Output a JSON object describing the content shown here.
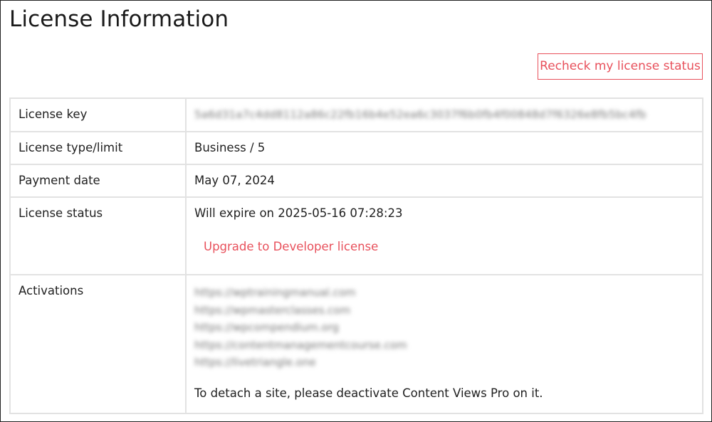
{
  "page": {
    "title": "License Information"
  },
  "actions": {
    "recheck_label": "Recheck my license status"
  },
  "table": {
    "rows": [
      {
        "label": "License key",
        "value": "5a6d31a7c4dd8112a86c22fb16b4e52ea6c3037f6b0fb4f00848d7f6326e8fb5bc4fb"
      },
      {
        "label": "License type/limit",
        "value": "Business / 5"
      },
      {
        "label": "Payment date",
        "value": "May 07, 2024"
      },
      {
        "label": "License status",
        "value": "Will expire on 2025-05-16 07:28:23"
      },
      {
        "label": "Activations",
        "value": ""
      }
    ],
    "upgrade_label": "Upgrade to Developer license",
    "activations": [
      "https://wptrainingmanual.com",
      "https://wpmasterclasses.com",
      "https://wpcompendium.org",
      "https://contentmanagementcourse.com",
      "https://livetriangle.one"
    ],
    "detach_note": "To detach a site, please deactivate Content Views Pro on it."
  },
  "colors": {
    "accent": "#e8505b",
    "border": "#e2e2e2"
  }
}
